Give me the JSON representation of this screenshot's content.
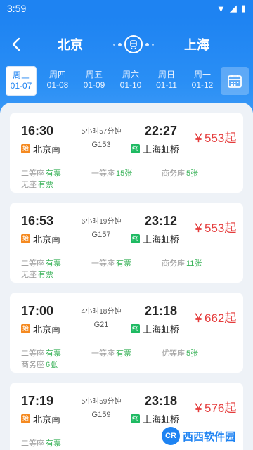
{
  "status": {
    "time": "3:59"
  },
  "header": {
    "from": "北京",
    "to": "上海"
  },
  "dates": [
    {
      "weekday": "周三",
      "date": "01-07",
      "active": true
    },
    {
      "weekday": "周四",
      "date": "01-08",
      "active": false
    },
    {
      "weekday": "周五",
      "date": "01-09",
      "active": false
    },
    {
      "weekday": "周六",
      "date": "01-10",
      "active": false
    },
    {
      "weekday": "周日",
      "date": "01-11",
      "active": false
    },
    {
      "weekday": "周一",
      "date": "01-12",
      "active": false
    }
  ],
  "colors": {
    "primary": "#1e83f2",
    "price": "#e53b3b",
    "green": "#3bb35a",
    "start_badge": "#f5891f",
    "end_badge": "#1eba62"
  },
  "trains": [
    {
      "dep_time": "16:30",
      "arr_time": "22:27",
      "duration": "5小时57分钟",
      "train_no": "G153",
      "dep_station": "北京南",
      "arr_station": "上海虹桥",
      "price": "￥553起",
      "start_badge": "始",
      "end_badge": "终",
      "seats": [
        {
          "name": "二等座",
          "value": "有票",
          "color": "green"
        },
        {
          "name": "一等座",
          "value": "15张",
          "color": "green"
        },
        {
          "name": "商务座",
          "value": "5张",
          "color": "green"
        },
        {
          "name": "无座",
          "value": "有票",
          "color": "green"
        }
      ]
    },
    {
      "dep_time": "16:53",
      "arr_time": "23:12",
      "duration": "6小时19分钟",
      "train_no": "G157",
      "dep_station": "北京南",
      "arr_station": "上海虹桥",
      "price": "￥553起",
      "start_badge": "始",
      "end_badge": "终",
      "seats": [
        {
          "name": "二等座",
          "value": "有票",
          "color": "green"
        },
        {
          "name": "一等座",
          "value": "有票",
          "color": "green"
        },
        {
          "name": "商务座",
          "value": "11张",
          "color": "green"
        },
        {
          "name": "无座",
          "value": "有票",
          "color": "green"
        }
      ]
    },
    {
      "dep_time": "17:00",
      "arr_time": "21:18",
      "duration": "4小时18分钟",
      "train_no": "G21",
      "dep_station": "北京南",
      "arr_station": "上海虹桥",
      "price": "￥662起",
      "start_badge": "始",
      "end_badge": "终",
      "seats": [
        {
          "name": "二等座",
          "value": "有票",
          "color": "green"
        },
        {
          "name": "一等座",
          "value": "有票",
          "color": "green"
        },
        {
          "name": "优等座",
          "value": "5张",
          "color": "green"
        },
        {
          "name": "商务座",
          "value": "6张",
          "color": "green"
        }
      ]
    },
    {
      "dep_time": "17:19",
      "arr_time": "23:18",
      "duration": "5小时59分钟",
      "train_no": "G159",
      "dep_station": "北京南",
      "arr_station": "上海虹桥",
      "price": "￥576起",
      "start_badge": "始",
      "end_badge": "终",
      "seats": [
        {
          "name": "二等座",
          "value": "有票",
          "color": "green"
        },
        {
          "name": "一等座",
          "value": "",
          "color": "green"
        },
        {
          "name": "",
          "value": "",
          "color": "green"
        },
        {
          "name": "",
          "value": "",
          "color": "green"
        }
      ]
    }
  ],
  "watermark": {
    "logo": "CR",
    "text": "西西软件园"
  }
}
